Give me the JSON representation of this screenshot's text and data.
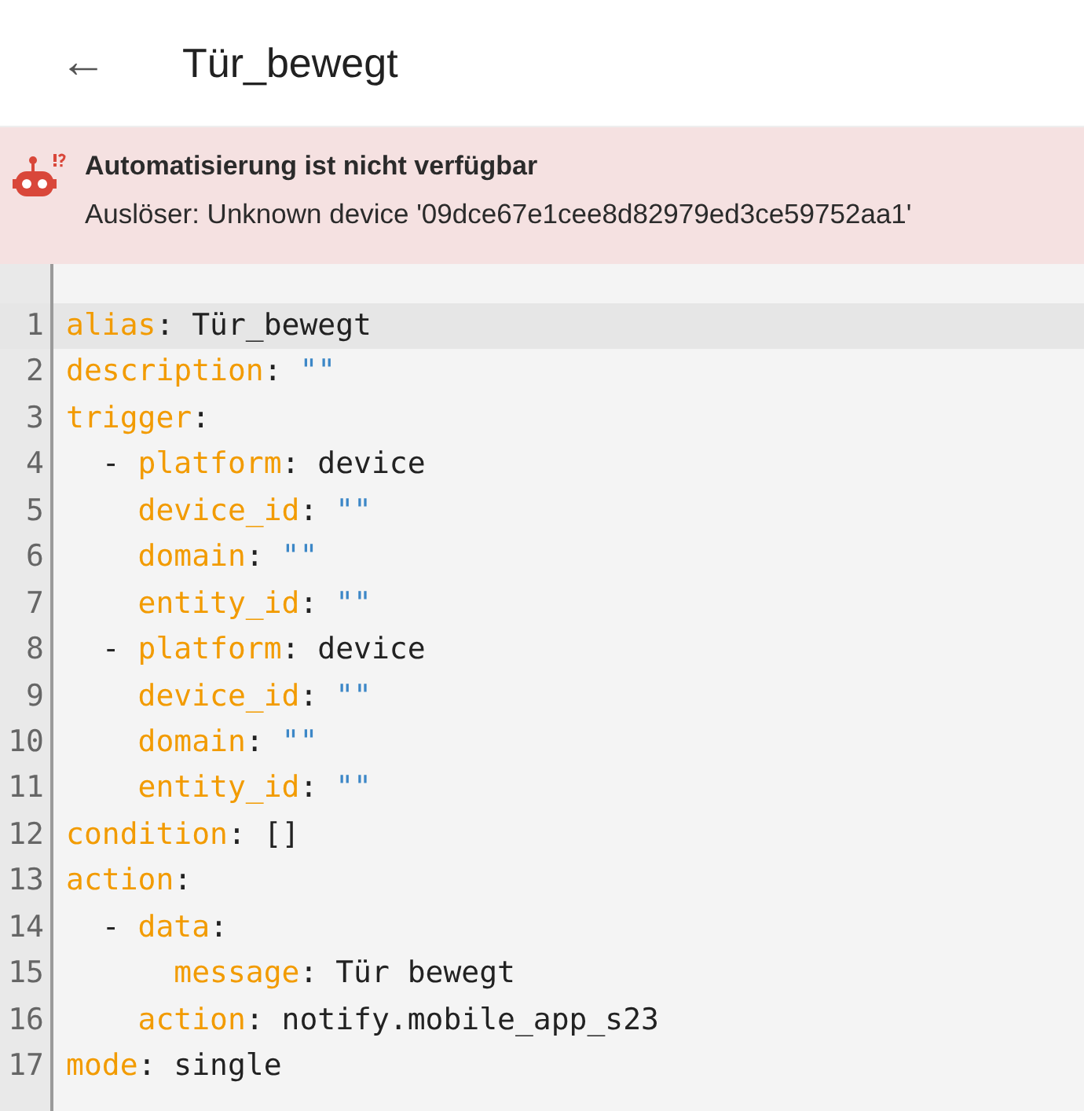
{
  "header": {
    "back": "←",
    "title": "Tür_bewegt"
  },
  "alert": {
    "title": "Automatisierung ist nicht verfügbar",
    "message": "Auslöser: Unknown device '09dce67e1cee8d82979ed3ce59752aa1'"
  },
  "editor": {
    "lines": [
      {
        "number": "1",
        "highlighted": true,
        "tokens": [
          {
            "text": "alias",
            "kind": "key"
          },
          {
            "text": ": ",
            "kind": "plain"
          },
          {
            "text": "Tür_bewegt",
            "kind": "plain"
          }
        ]
      },
      {
        "number": "2",
        "highlighted": false,
        "tokens": [
          {
            "text": "description",
            "kind": "key"
          },
          {
            "text": ": ",
            "kind": "plain"
          },
          {
            "text": "\"\"",
            "kind": "string"
          }
        ]
      },
      {
        "number": "3",
        "highlighted": false,
        "tokens": [
          {
            "text": "trigger",
            "kind": "key"
          },
          {
            "text": ":",
            "kind": "plain"
          }
        ]
      },
      {
        "number": "4",
        "highlighted": false,
        "tokens": [
          {
            "text": "  - ",
            "kind": "plain"
          },
          {
            "text": "platform",
            "kind": "key"
          },
          {
            "text": ": ",
            "kind": "plain"
          },
          {
            "text": "device",
            "kind": "plain"
          }
        ]
      },
      {
        "number": "5",
        "highlighted": false,
        "tokens": [
          {
            "text": "    device_id",
            "kind": "key"
          },
          {
            "text": ": ",
            "kind": "plain"
          },
          {
            "text": "\"\"",
            "kind": "string"
          }
        ]
      },
      {
        "number": "6",
        "highlighted": false,
        "tokens": [
          {
            "text": "    domain",
            "kind": "key"
          },
          {
            "text": ": ",
            "kind": "plain"
          },
          {
            "text": "\"\"",
            "kind": "string"
          }
        ]
      },
      {
        "number": "7",
        "highlighted": false,
        "tokens": [
          {
            "text": "    entity_id",
            "kind": "key"
          },
          {
            "text": ": ",
            "kind": "plain"
          },
          {
            "text": "\"\"",
            "kind": "string"
          }
        ]
      },
      {
        "number": "8",
        "highlighted": false,
        "tokens": [
          {
            "text": "  - ",
            "kind": "plain"
          },
          {
            "text": "platform",
            "kind": "key"
          },
          {
            "text": ": ",
            "kind": "plain"
          },
          {
            "text": "device",
            "kind": "plain"
          }
        ]
      },
      {
        "number": "9",
        "highlighted": false,
        "tokens": [
          {
            "text": "    device_id",
            "kind": "key"
          },
          {
            "text": ": ",
            "kind": "plain"
          },
          {
            "text": "\"\"",
            "kind": "string"
          }
        ]
      },
      {
        "number": "10",
        "highlighted": false,
        "tokens": [
          {
            "text": "    domain",
            "kind": "key"
          },
          {
            "text": ": ",
            "kind": "plain"
          },
          {
            "text": "\"\"",
            "kind": "string"
          }
        ]
      },
      {
        "number": "11",
        "highlighted": false,
        "tokens": [
          {
            "text": "    entity_id",
            "kind": "key"
          },
          {
            "text": ": ",
            "kind": "plain"
          },
          {
            "text": "\"\"",
            "kind": "string"
          }
        ]
      },
      {
        "number": "12",
        "highlighted": false,
        "tokens": [
          {
            "text": "condition",
            "kind": "key"
          },
          {
            "text": ": ",
            "kind": "plain"
          },
          {
            "text": "[]",
            "kind": "plain"
          }
        ]
      },
      {
        "number": "13",
        "highlighted": false,
        "tokens": [
          {
            "text": "action",
            "kind": "key"
          },
          {
            "text": ":",
            "kind": "plain"
          }
        ]
      },
      {
        "number": "14",
        "highlighted": false,
        "tokens": [
          {
            "text": "  - ",
            "kind": "plain"
          },
          {
            "text": "data",
            "kind": "key"
          },
          {
            "text": ":",
            "kind": "plain"
          }
        ]
      },
      {
        "number": "15",
        "highlighted": false,
        "tokens": [
          {
            "text": "      message",
            "kind": "key"
          },
          {
            "text": ": ",
            "kind": "plain"
          },
          {
            "text": "Tür bewegt",
            "kind": "plain"
          }
        ]
      },
      {
        "number": "16",
        "highlighted": false,
        "tokens": [
          {
            "text": "    action",
            "kind": "key"
          },
          {
            "text": ": ",
            "kind": "plain"
          },
          {
            "text": "notify.mobile_app_s23",
            "kind": "plain"
          }
        ]
      },
      {
        "number": "17",
        "highlighted": false,
        "tokens": [
          {
            "text": "mode",
            "kind": "key"
          },
          {
            "text": ": ",
            "kind": "plain"
          },
          {
            "text": "single",
            "kind": "plain"
          }
        ]
      }
    ]
  }
}
